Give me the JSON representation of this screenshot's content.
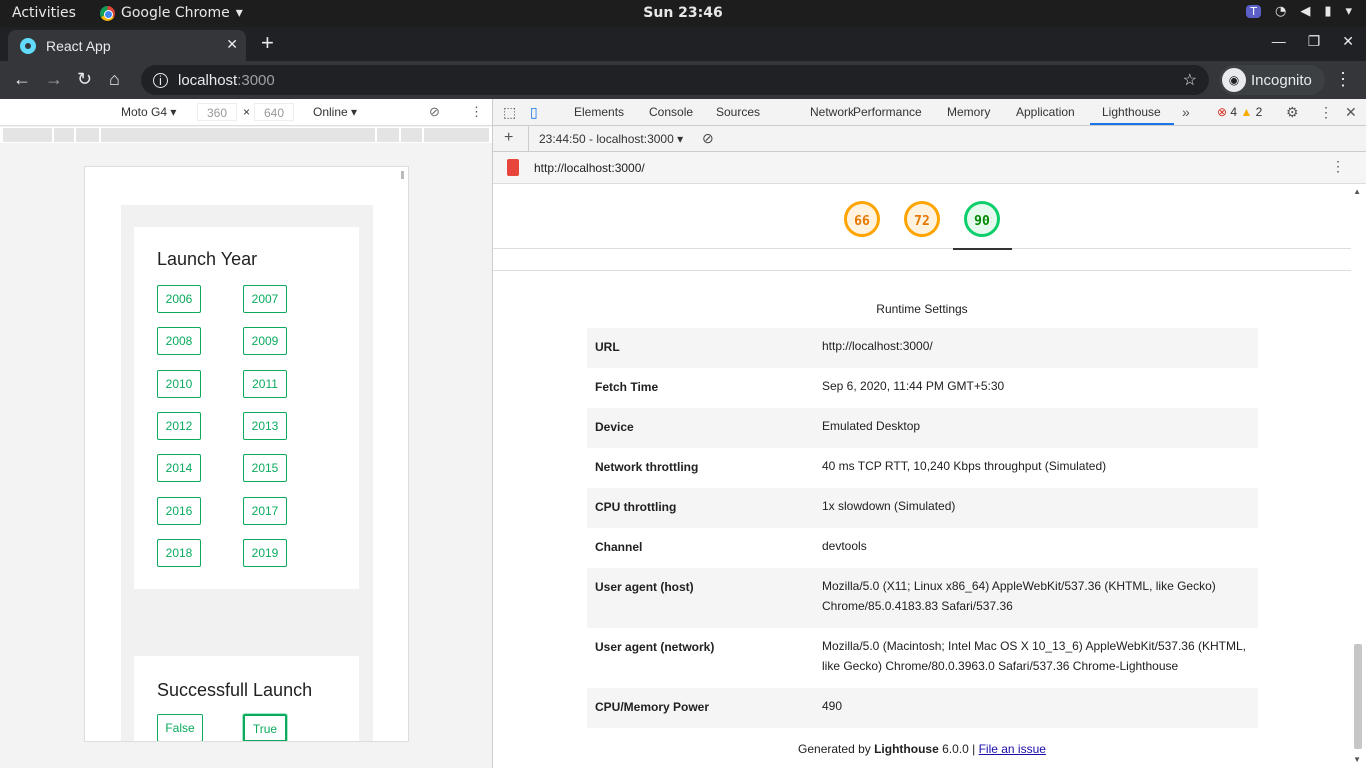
{
  "os": {
    "activities": "Activities",
    "app_name": "Google Chrome",
    "clock": "Sun 23:46"
  },
  "browser": {
    "tab_title": "React App",
    "url_host": "localhost",
    "url_port": ":3000",
    "incognito_label": "Incognito"
  },
  "device_toolbar": {
    "device": "Moto G4",
    "width": "360",
    "height": "640",
    "network": "Online"
  },
  "app": {
    "launch_year_title": "Launch Year",
    "years": [
      "2006",
      "2007",
      "2008",
      "2009",
      "2010",
      "2011",
      "2012",
      "2013",
      "2014",
      "2015",
      "2016",
      "2017",
      "2018",
      "2019"
    ],
    "success_title": "Successfull Launch",
    "success_options": [
      "False",
      "True"
    ],
    "selected_success": "True"
  },
  "devtools": {
    "tabs": [
      "Elements",
      "Console",
      "Sources",
      "Network",
      "Performance",
      "Memory",
      "Application",
      "Lighthouse"
    ],
    "active_tab": "Lighthouse",
    "errors": "4",
    "warnings": "2",
    "report_select": "23:44:50 - localhost:3000",
    "report_url": "http://localhost:3000/",
    "scores": [
      {
        "value": "66",
        "level": "average"
      },
      {
        "value": "72",
        "level": "average"
      },
      {
        "value": "90",
        "level": "pass"
      }
    ],
    "runtime_title": "Runtime Settings",
    "runtime": [
      {
        "key": "URL",
        "value": "http://localhost:3000/"
      },
      {
        "key": "Fetch Time",
        "value": "Sep 6, 2020, 11:44 PM GMT+5:30"
      },
      {
        "key": "Device",
        "value": "Emulated Desktop"
      },
      {
        "key": "Network throttling",
        "value": "40 ms TCP RTT, 10,240 Kbps throughput (Simulated)"
      },
      {
        "key": "CPU throttling",
        "value": "1x slowdown (Simulated)"
      },
      {
        "key": "Channel",
        "value": "devtools"
      },
      {
        "key": "User agent (host)",
        "value": "Mozilla/5.0 (X11; Linux x86_64) AppleWebKit/537.36 (KHTML, like Gecko) Chrome/85.0.4183.83 Safari/537.36"
      },
      {
        "key": "User agent (network)",
        "value": "Mozilla/5.0 (Macintosh; Intel Mac OS X 10_13_6) AppleWebKit/537.36 (KHTML, like Gecko) Chrome/80.0.3963.0 Safari/537.36 Chrome-Lighthouse"
      },
      {
        "key": "CPU/Memory Power",
        "value": "490"
      }
    ],
    "footer_prefix": "Generated by ",
    "footer_brand": "Lighthouse",
    "footer_version": " 6.0.0 | ",
    "footer_link": "File an issue"
  },
  "colors": {
    "accent_green": "#0bab5e",
    "score_average": "#ffa400",
    "score_pass": "#0cce6b"
  }
}
